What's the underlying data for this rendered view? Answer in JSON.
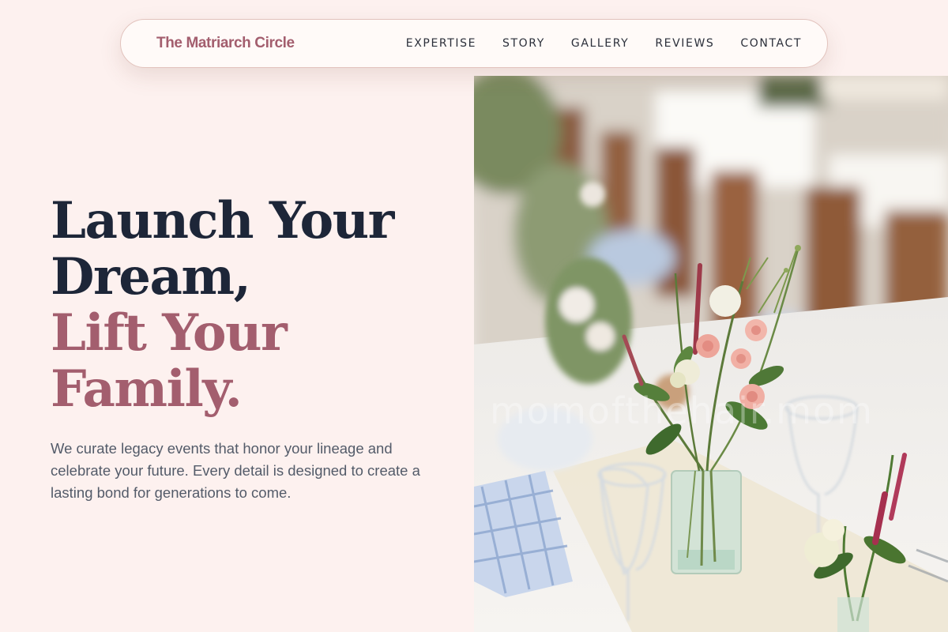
{
  "nav": {
    "brand": "The Matriarch Circle",
    "links": [
      "EXPERTISE",
      "STORY",
      "GALLERY",
      "REVIEWS",
      "CONTACT"
    ]
  },
  "hero": {
    "headline_line1": "Launch Your",
    "headline_line2": "Dream,",
    "headline_line3": "Lift Your",
    "headline_line4": "Family.",
    "description": "We curate legacy events that honor your lineage and celebrate your future. Every detail is designed to create a lasting bond for generations to come.",
    "image_watermark": "momofthehair.mom"
  },
  "colors": {
    "background": "#fdf1ef",
    "accent": "#a35e6e",
    "heading": "#1d2638",
    "body_text": "#535b69"
  }
}
